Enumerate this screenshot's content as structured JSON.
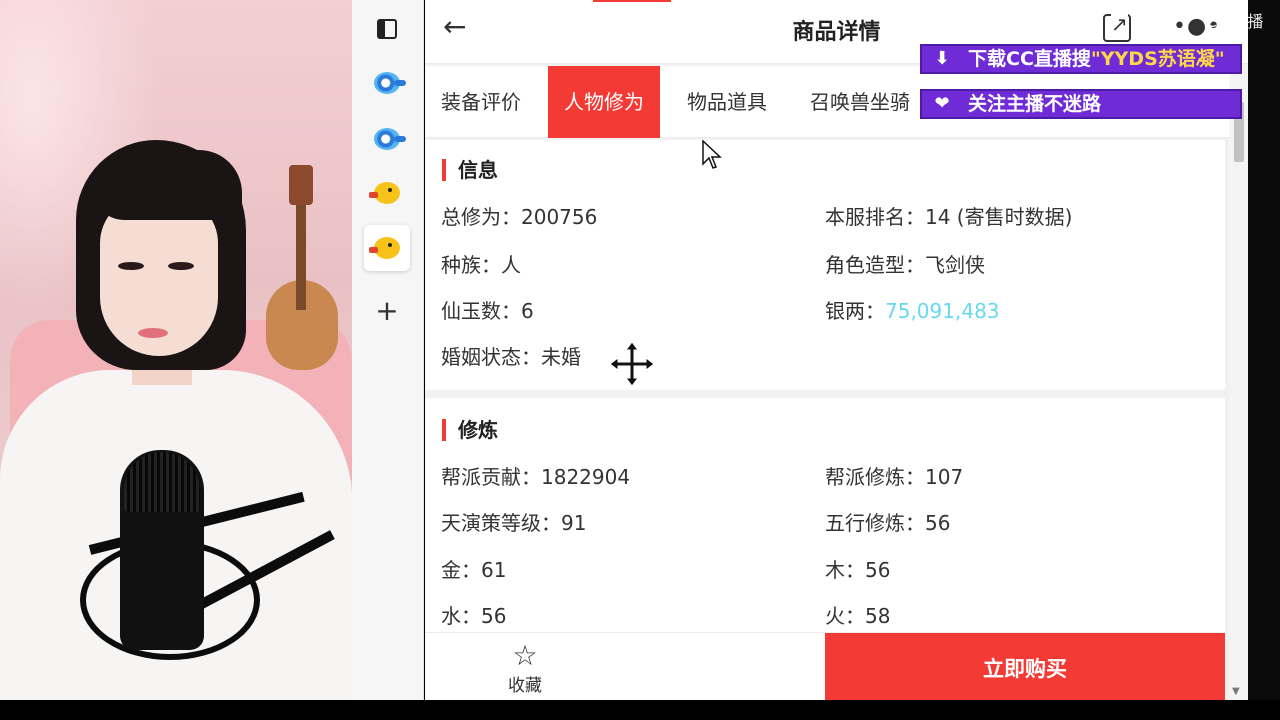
{
  "page": {
    "title": "商品详情",
    "back_icon": "arrow-left-icon",
    "share_icon": "share-icon",
    "more_icon": "more-icon"
  },
  "tabs": [
    {
      "label": "装备评价",
      "active": false
    },
    {
      "label": "人物修为",
      "active": true
    },
    {
      "label": "物品道具",
      "active": false
    },
    {
      "label": "召唤兽坐骑",
      "active": false
    }
  ],
  "info": {
    "title": "信息",
    "rows": [
      {
        "left": "总修为：200756",
        "right_label": "本服排名：",
        "right_value": "14 (寄售时数据)"
      },
      {
        "left": "种族：人",
        "right_label": "角色造型：",
        "right_value": "飞剑侠"
      },
      {
        "left": "仙玉数：6",
        "right_label": "银两：",
        "right_value": "75,091,483"
      },
      {
        "left": "婚姻状态：未婚",
        "right_label": "",
        "right_value": ""
      }
    ]
  },
  "cultivation": {
    "title": "修炼",
    "rows": [
      {
        "left": "帮派贡献：1822904",
        "right": "帮派修炼：107"
      },
      {
        "left": "天演策等级：91",
        "right": "五行修炼：56"
      },
      {
        "left": "金：61",
        "right": "木：56"
      },
      {
        "left": "水：56",
        "right": "火：58"
      }
    ]
  },
  "bottom": {
    "favorite_label": "收藏",
    "favorite_icon": "☆",
    "buy_label": "立即购买"
  },
  "overlays": {
    "line1_prefix": "下载CC直播搜",
    "line1_highlight": "\"YYDS苏语凝\"",
    "line2": "关注主播不迷路",
    "watermark": "CC直播"
  },
  "colors": {
    "accent": "#f33a35",
    "silver_value": "#66d9ee",
    "overlay": "#6e2bd6"
  }
}
